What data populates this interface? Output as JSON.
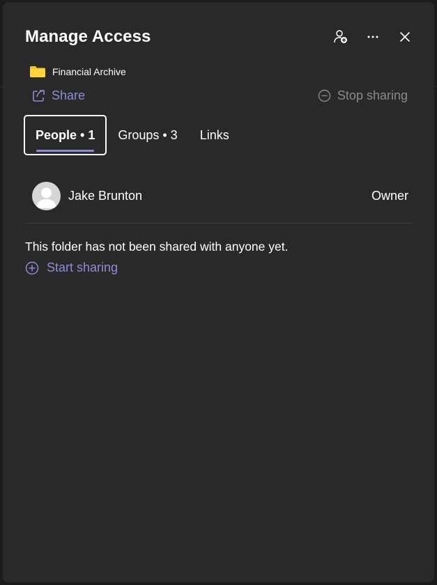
{
  "panel": {
    "title": "Manage Access",
    "icons": {
      "add_person": "person-add-icon",
      "more": "more-options-icon",
      "close": "close-icon"
    }
  },
  "item": {
    "icon": "folder-icon",
    "name": "Financial Archive"
  },
  "actions": {
    "share_label": "Share",
    "stop_sharing_label": "Stop sharing"
  },
  "tabs": [
    {
      "label": "People • 1",
      "active": true
    },
    {
      "label": "Groups • 3",
      "active": false
    },
    {
      "label": "Links",
      "active": false
    }
  ],
  "people": [
    {
      "name": "Jake Brunton",
      "role": "Owner"
    }
  ],
  "empty_state": {
    "message": "This folder has not been shared with anyone yet.",
    "cta_label": "Start sharing"
  },
  "colors": {
    "panel_bg": "#292929",
    "accent": "#8e8cd8",
    "muted": "#8a8a8a",
    "folder": "#f5c228"
  }
}
